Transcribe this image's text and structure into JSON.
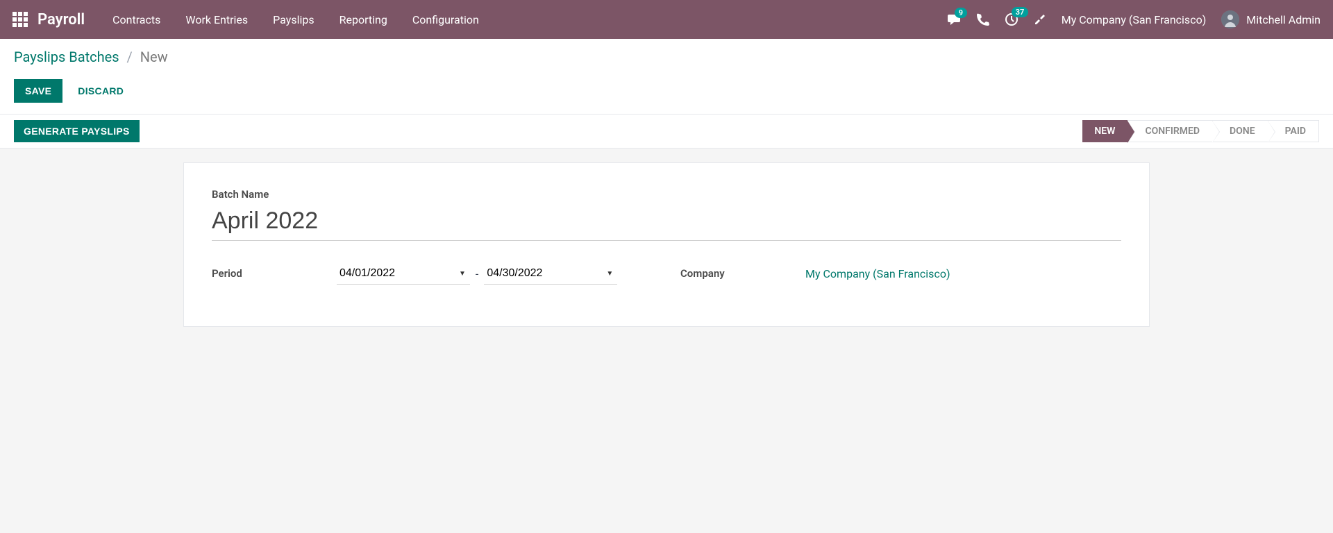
{
  "topnav": {
    "app_title": "Payroll",
    "links": [
      "Contracts",
      "Work Entries",
      "Payslips",
      "Reporting",
      "Configuration"
    ],
    "messages_badge": "9",
    "activities_badge": "37",
    "company": "My Company (San Francisco)",
    "user": "Mitchell Admin"
  },
  "breadcrumb": {
    "primary": "Payslips Batches",
    "current": "New"
  },
  "actions": {
    "save": "SAVE",
    "discard": "DISCARD",
    "generate": "GENERATE PAYSLIPS"
  },
  "status": {
    "steps": [
      "NEW",
      "CONFIRMED",
      "DONE",
      "PAID"
    ],
    "active_index": 0
  },
  "form": {
    "batch_name_label": "Batch Name",
    "batch_name_value": "April 2022",
    "period_label": "Period",
    "date_from": "04/01/2022",
    "date_to": "04/30/2022",
    "company_label": "Company",
    "company_value": "My Company (San Francisco)"
  }
}
